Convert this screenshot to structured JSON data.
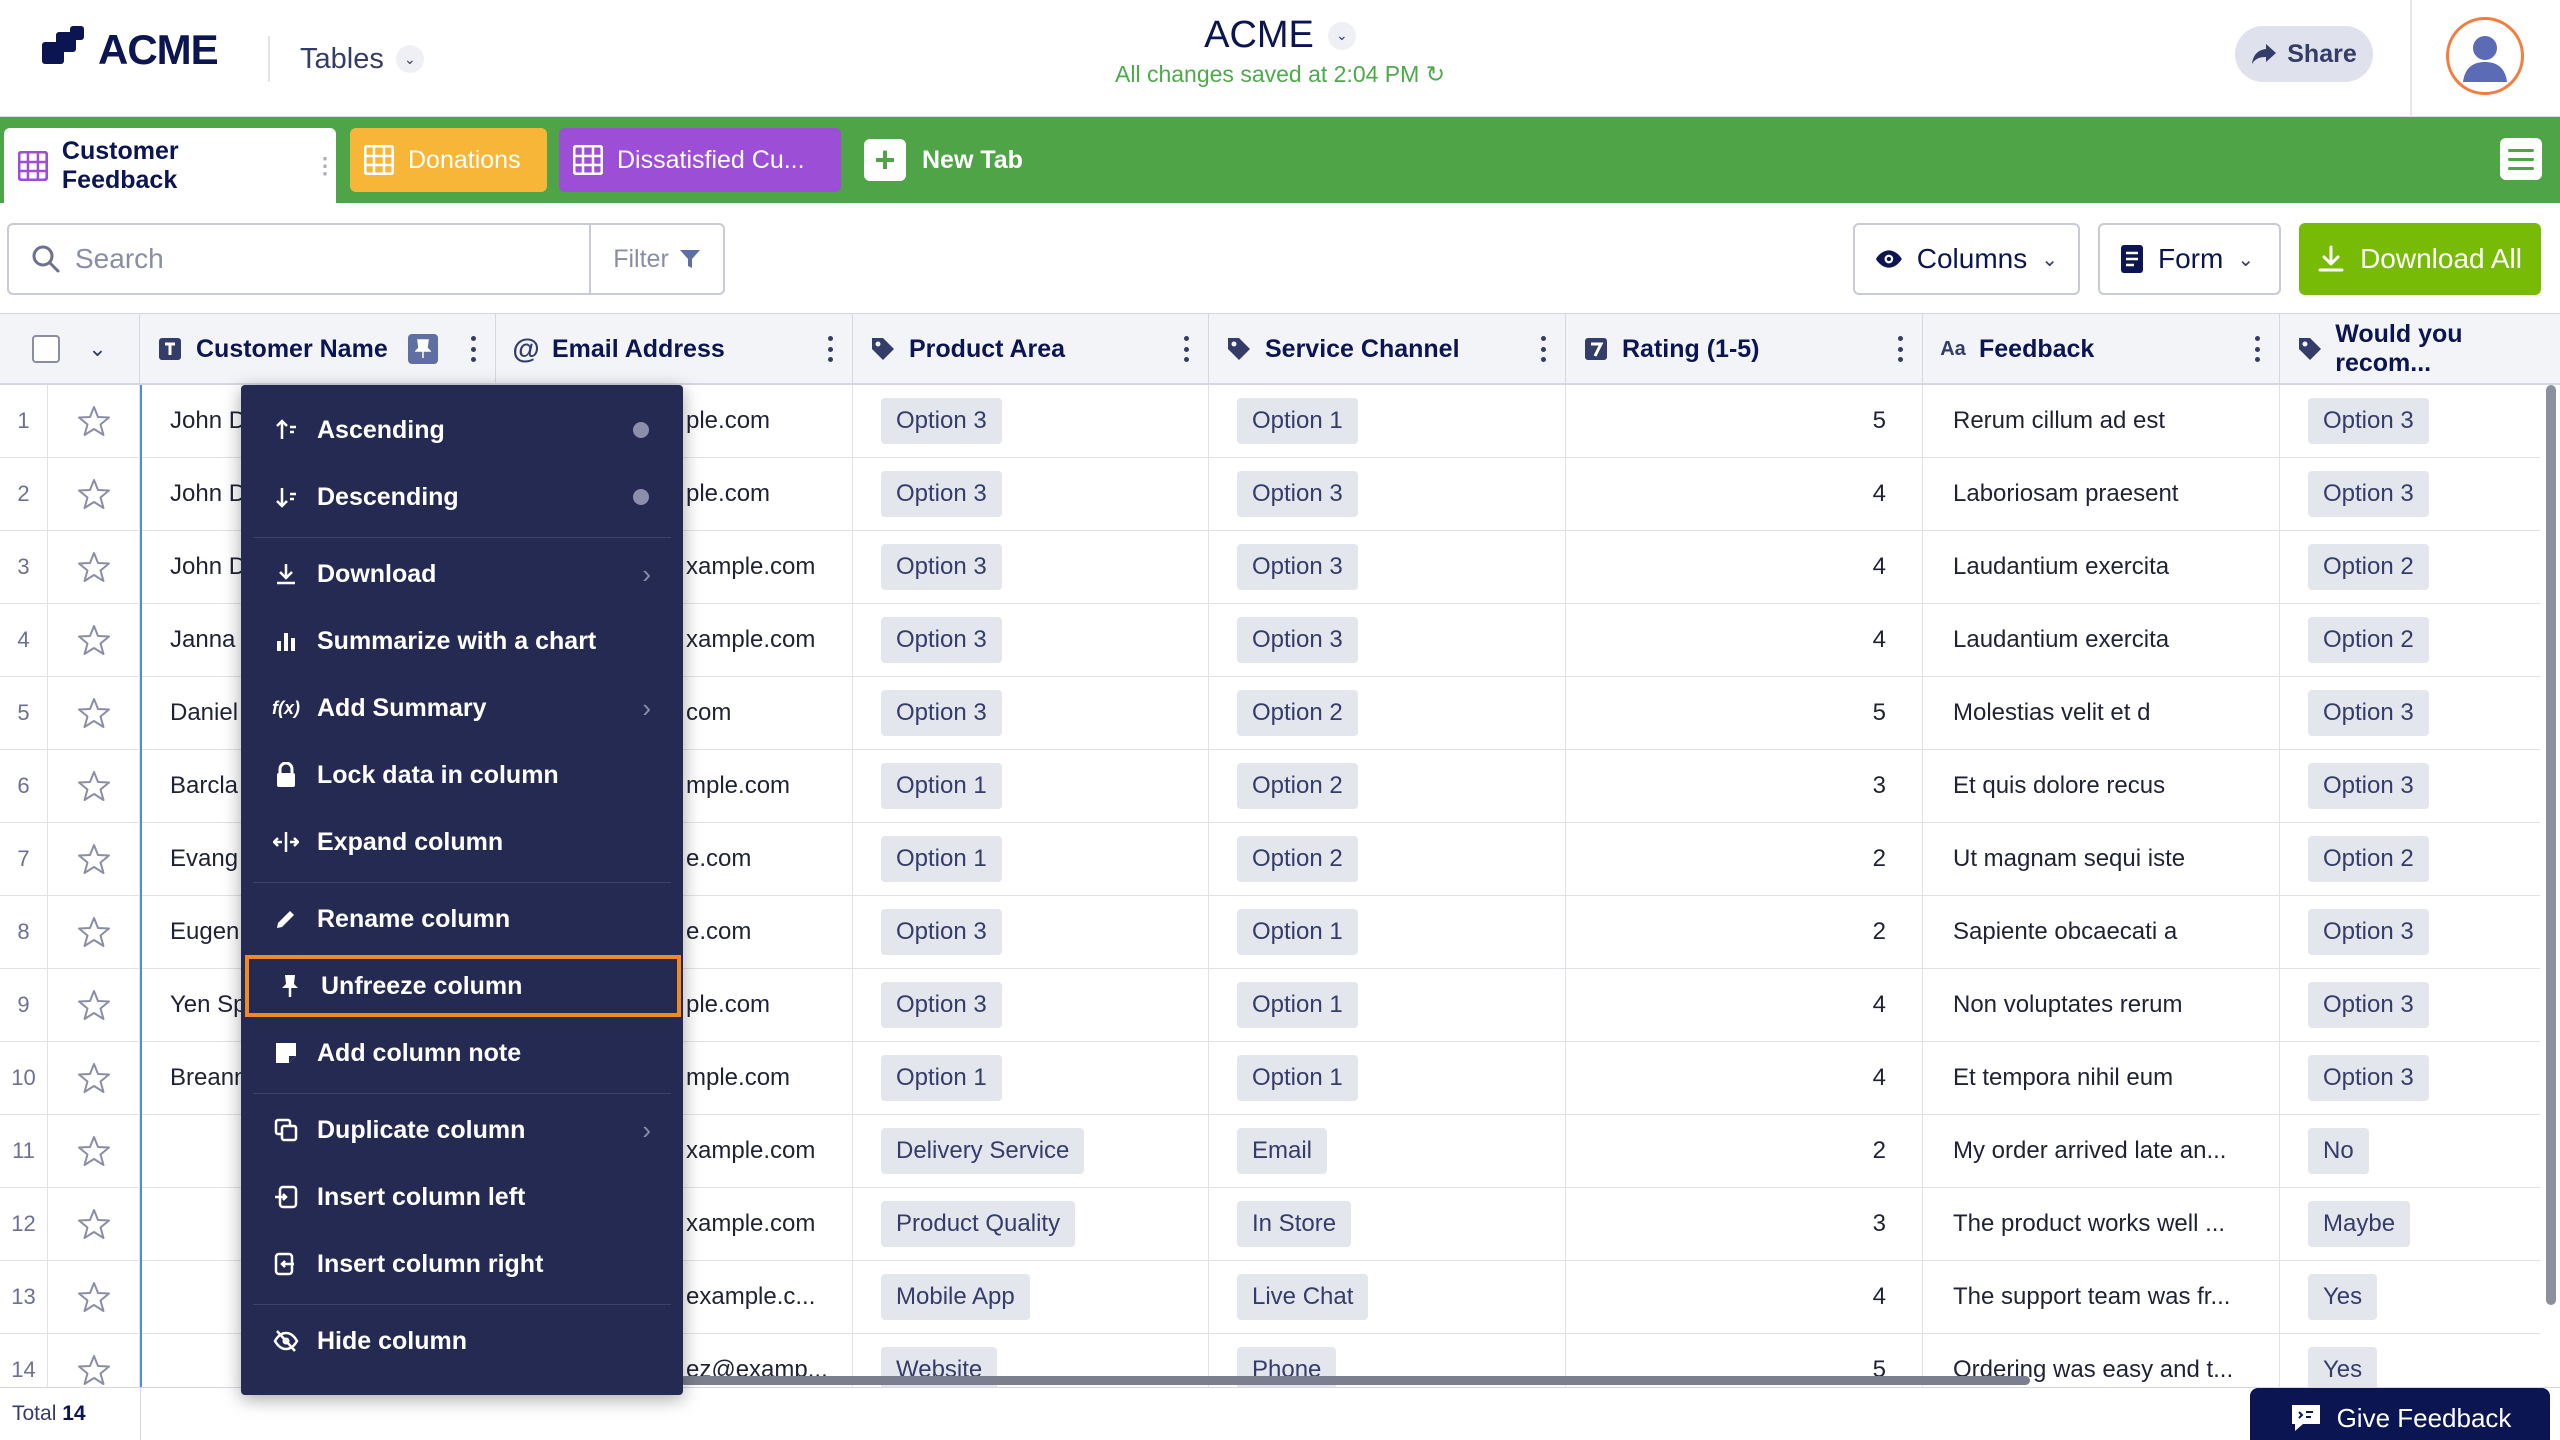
{
  "header": {
    "logo_text": "ACME",
    "tables_label": "Tables",
    "app_title": "ACME",
    "save_status": "All changes saved at 2:04 PM",
    "share_label": "Share"
  },
  "tabs": {
    "items": [
      {
        "label": "Customer Feedback",
        "color": "#ffffff"
      },
      {
        "label": "Donations",
        "color": "#f7b637"
      },
      {
        "label": "Dissatisfied Cu...",
        "color": "#9d4ed6"
      }
    ],
    "new_tab_label": "New Tab",
    "bar_color": "#4ea446"
  },
  "toolbar": {
    "search_placeholder": "Search",
    "filter_label": "Filter",
    "columns_label": "Columns",
    "form_label": "Form",
    "download_label": "Download All"
  },
  "columns": [
    {
      "label": "Customer Name",
      "icon": "text-type-icon"
    },
    {
      "label": "Email Address",
      "icon": "at-icon"
    },
    {
      "label": "Product Area",
      "icon": "tag-icon"
    },
    {
      "label": "Service Channel",
      "icon": "tag-icon"
    },
    {
      "label": "Rating (1-5)",
      "icon": "number-icon"
    },
    {
      "label": "Feedback",
      "icon": "long-text-icon"
    },
    {
      "label": "Would you recom...",
      "icon": "tag-icon"
    }
  ],
  "rows": [
    {
      "num": "1",
      "name": "John D",
      "email": "ple.com",
      "area": "Option 3",
      "channel": "Option 1",
      "rating": "5",
      "feedback": "Rerum cillum ad est",
      "recommend": "Option 3"
    },
    {
      "num": "2",
      "name": "John D",
      "email": "ple.com",
      "area": "Option 3",
      "channel": "Option 3",
      "rating": "4",
      "feedback": "Laboriosam praesent",
      "recommend": "Option 3"
    },
    {
      "num": "3",
      "name": "John D",
      "email": "xample.com",
      "area": "Option 3",
      "channel": "Option 3",
      "rating": "4",
      "feedback": "Laudantium exercita",
      "recommend": "Option 2"
    },
    {
      "num": "4",
      "name": "Janna",
      "email": "xample.com",
      "area": "Option 3",
      "channel": "Option 3",
      "rating": "4",
      "feedback": "Laudantium exercita",
      "recommend": "Option 2"
    },
    {
      "num": "5",
      "name": "Daniel",
      "email": "com",
      "area": "Option 3",
      "channel": "Option 2",
      "rating": "5",
      "feedback": "Molestias velit et d",
      "recommend": "Option 3"
    },
    {
      "num": "6",
      "name": "Barcla",
      "email": "mple.com",
      "area": "Option 1",
      "channel": "Option 2",
      "rating": "3",
      "feedback": "Et quis dolore recus",
      "recommend": "Option 3"
    },
    {
      "num": "7",
      "name": "Evang",
      "email": "e.com",
      "area": "Option 1",
      "channel": "Option 2",
      "rating": "2",
      "feedback": "Ut magnam sequi iste",
      "recommend": "Option 2"
    },
    {
      "num": "8",
      "name": "Eugen",
      "email": "e.com",
      "area": "Option 3",
      "channel": "Option 1",
      "rating": "2",
      "feedback": "Sapiente obcaecati a",
      "recommend": "Option 3"
    },
    {
      "num": "9",
      "name": "Yen Sp",
      "email": "ple.com",
      "area": "Option 3",
      "channel": "Option 1",
      "rating": "4",
      "feedback": "Non voluptates rerum",
      "recommend": "Option 3"
    },
    {
      "num": "10",
      "name": "Breann",
      "email": "mple.com",
      "area": "Option 1",
      "channel": "Option 1",
      "rating": "4",
      "feedback": "Et tempora nihil eum",
      "recommend": "Option 3"
    },
    {
      "num": "11",
      "name": "",
      "email": "xample.com",
      "area": "Delivery Service",
      "channel": "Email",
      "rating": "2",
      "feedback": "My order arrived late an...",
      "recommend": "No"
    },
    {
      "num": "12",
      "name": "",
      "email": "xample.com",
      "area": "Product Quality",
      "channel": "In Store",
      "rating": "3",
      "feedback": "The product works well ...",
      "recommend": "Maybe"
    },
    {
      "num": "13",
      "name": "",
      "email": "example.c...",
      "area": "Mobile App",
      "channel": "Live Chat",
      "rating": "4",
      "feedback": "The support team was fr...",
      "recommend": "Yes"
    },
    {
      "num": "14",
      "name": "",
      "email": "ez@examp...",
      "area": "Website",
      "channel": "Phone",
      "rating": "5",
      "feedback": "Ordering was easy and t...",
      "recommend": "Yes"
    }
  ],
  "context_menu": {
    "items": [
      {
        "label": "Ascending",
        "icon": "sort-ascending-icon",
        "trail": "dot"
      },
      {
        "label": "Descending",
        "icon": "sort-descending-icon",
        "trail": "dot"
      },
      {
        "label": "Download",
        "icon": "download-icon",
        "trail": "arrow"
      },
      {
        "label": "Summarize with a chart",
        "icon": "bar-chart-icon",
        "trail": ""
      },
      {
        "label": "Add Summary",
        "icon": "function-icon",
        "trail": "arrow"
      },
      {
        "label": "Lock data in column",
        "icon": "lock-icon",
        "trail": ""
      },
      {
        "label": "Expand column",
        "icon": "expand-icon",
        "trail": ""
      },
      {
        "label": "Rename column",
        "icon": "pencil-icon",
        "trail": ""
      },
      {
        "label": "Unfreeze column",
        "icon": "pin-icon",
        "trail": ""
      },
      {
        "label": "Add column note",
        "icon": "note-icon",
        "trail": ""
      },
      {
        "label": "Duplicate column",
        "icon": "duplicate-icon",
        "trail": "arrow"
      },
      {
        "label": "Insert column left",
        "icon": "insert-left-icon",
        "trail": ""
      },
      {
        "label": "Insert column right",
        "icon": "insert-right-icon",
        "trail": ""
      },
      {
        "label": "Hide column",
        "icon": "eye-off-icon",
        "trail": ""
      }
    ],
    "highlighted": "Unfreeze column",
    "highlight_color": "#f08a24"
  },
  "footer": {
    "total_label": "Total",
    "total_count": "14",
    "give_feedback_label": "Give Feedback"
  },
  "colors": {
    "brand_navy": "#0a1551",
    "download_green": "#78bb07",
    "save_green": "#4caa4a",
    "menu_bg": "#252a52"
  }
}
